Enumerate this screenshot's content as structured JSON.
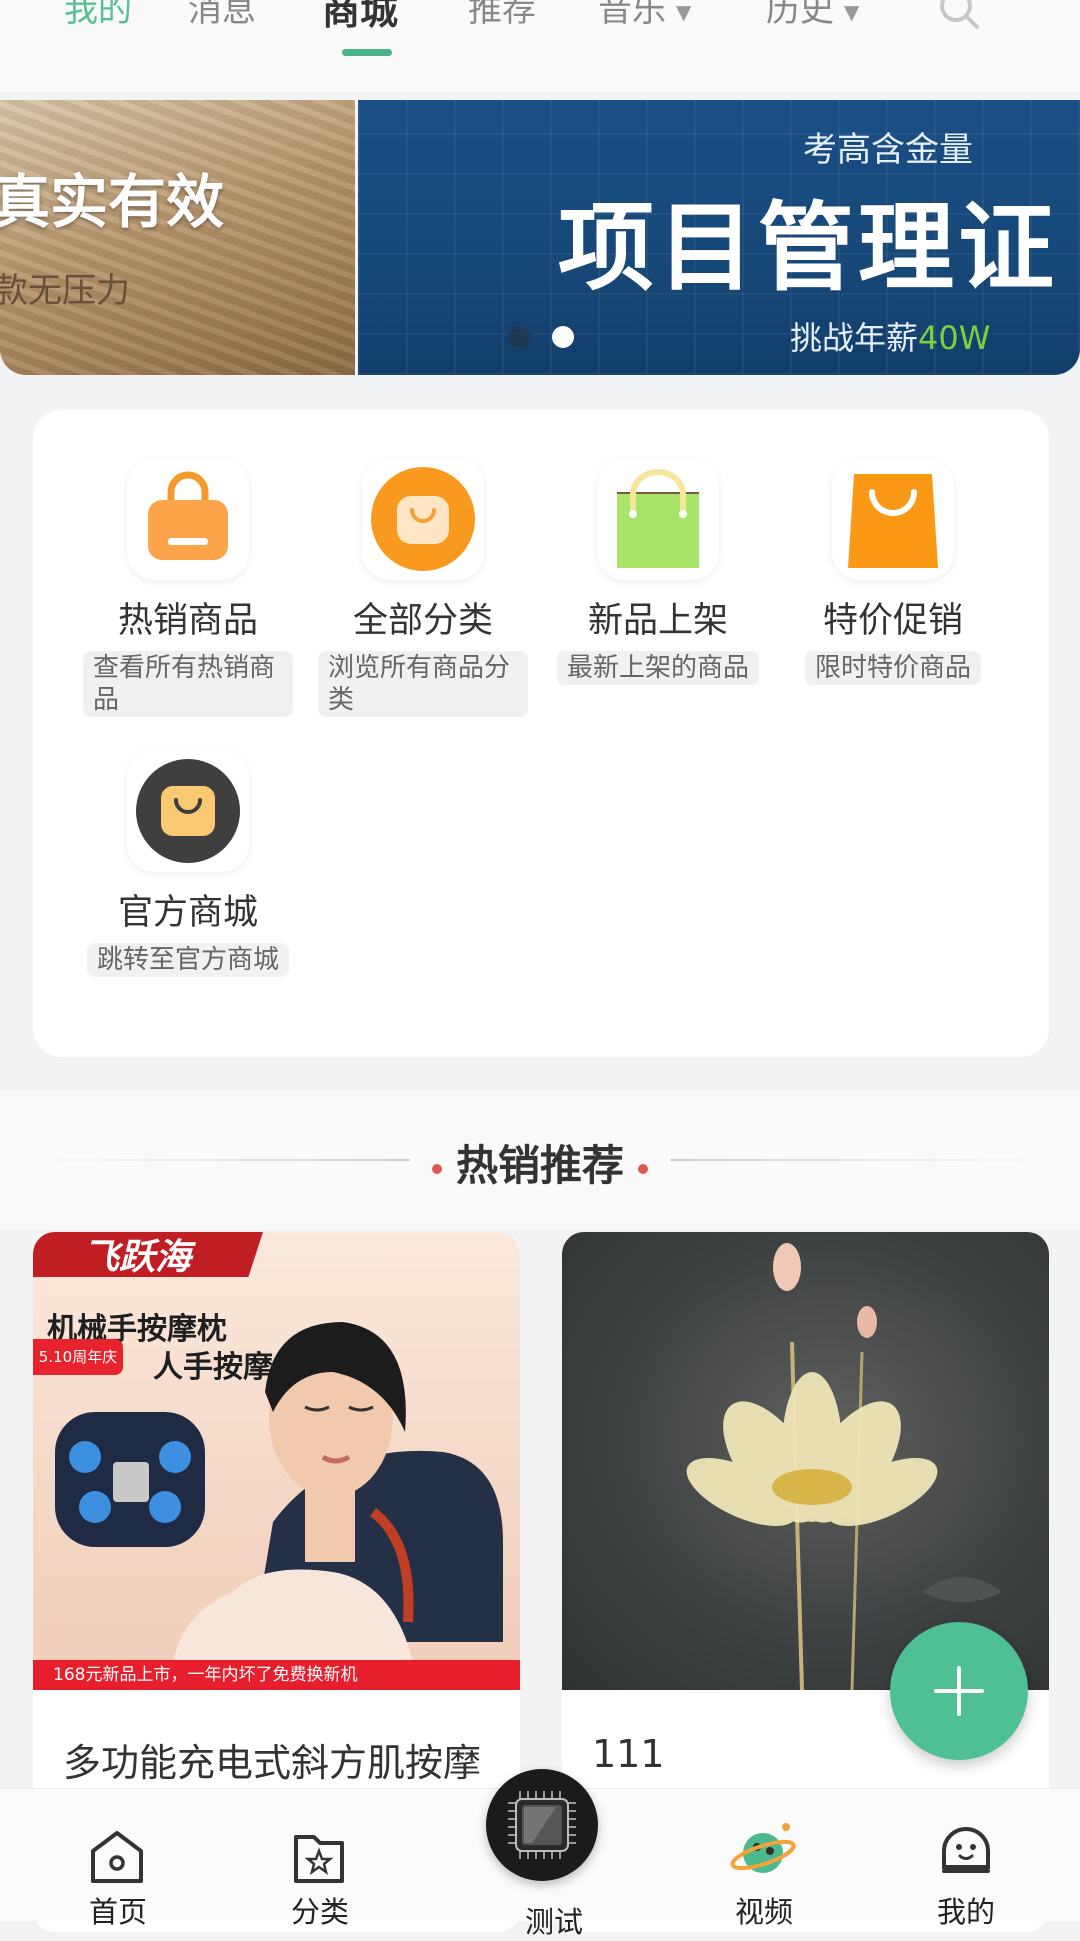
{
  "top_tabs": {
    "mine": "我的",
    "messages": "消息",
    "mall": "商城",
    "recommend": "推荐",
    "music": "音乐",
    "history": "历史"
  },
  "banner": {
    "left_line1": "真实有效",
    "left_line2": "款无压力",
    "right_small": "考高含金量",
    "right_big": "项目管理证",
    "right_salary_prefix": "挑战年薪",
    "right_salary_value": "40W"
  },
  "categories": [
    {
      "title": "热销商品",
      "desc": "查看所有热销商品",
      "icon": "orange-bag-icon"
    },
    {
      "title": "全部分类",
      "desc": "浏览所有商品分类",
      "icon": "orange-round-bag-icon"
    },
    {
      "title": "新品上架",
      "desc": "最新上架的商品",
      "icon": "green-shopping-bag-icon"
    },
    {
      "title": "特价促销",
      "desc": "限时特价商品",
      "icon": "orange-paper-bag-icon"
    },
    {
      "title": "官方商城",
      "desc": "跳转至官方商城",
      "icon": "dark-round-bag-icon"
    }
  ],
  "section_title": "热销推荐",
  "products": [
    {
      "name": "多功能充电式斜方肌按摩",
      "image_text": {
        "brand": "飞跃海",
        "headline1": "机械手按摩枕",
        "headline2": "人手按摩",
        "anniversary": "5.10周年庆",
        "footer": "168元新品上市，一年内坏了免费换新机"
      }
    },
    {
      "name": "111"
    }
  ],
  "bottom_nav": [
    "首页",
    "分类",
    "测试",
    "视频",
    "我的"
  ],
  "colors": {
    "accent": "#4fbf94",
    "tab_indicator": "#49b48a",
    "banner_blue": "#164878",
    "salary_green": "#7fd13b",
    "section_dot": "#e25a4f"
  }
}
